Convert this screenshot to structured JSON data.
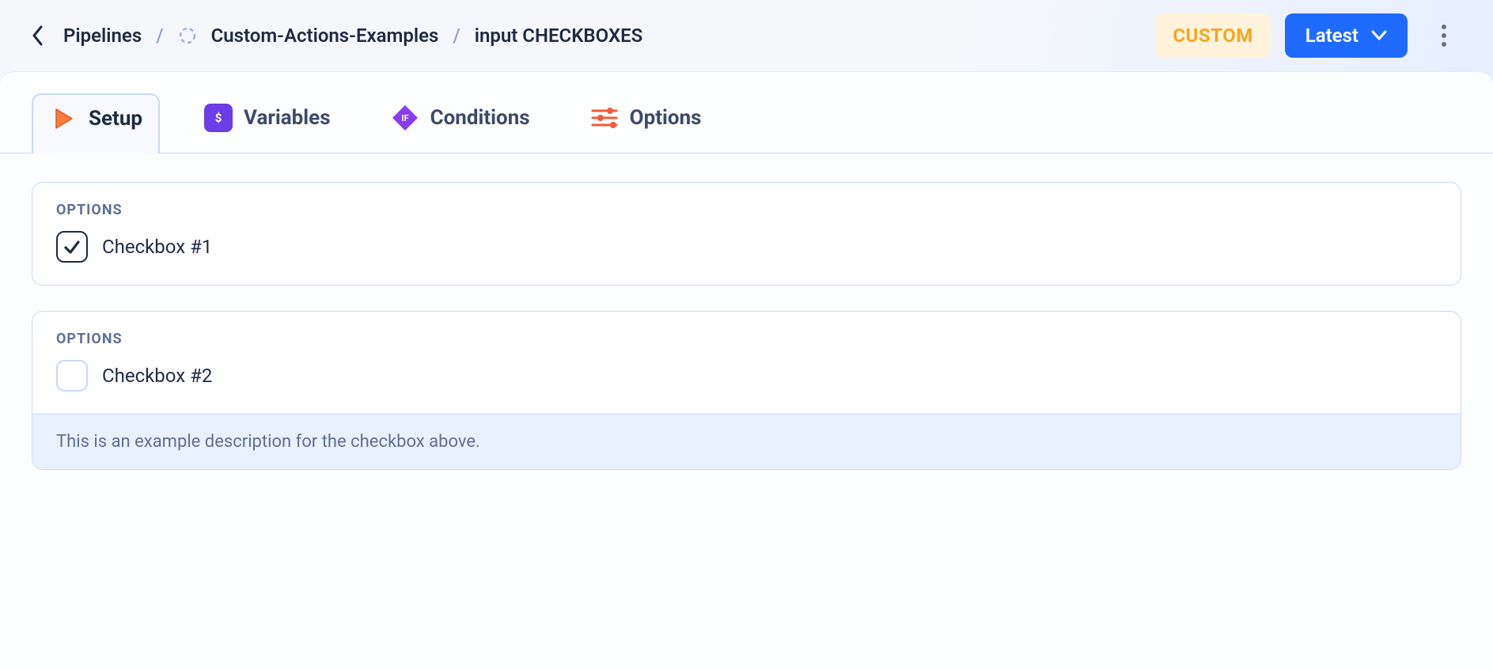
{
  "breadcrumbs": {
    "root": "Pipelines",
    "project": "Custom-Actions-Examples",
    "current": "input CHECKBOXES"
  },
  "header": {
    "custom_badge": "CUSTOM",
    "version_button": "Latest"
  },
  "tabs": {
    "setup": "Setup",
    "variables": "Variables",
    "conditions": "Conditions",
    "options": "Options",
    "active": "setup"
  },
  "panels": [
    {
      "title": "OPTIONS",
      "checkbox_label": "Checkbox #1",
      "checked": true
    },
    {
      "title": "OPTIONS",
      "checkbox_label": "Checkbox #2",
      "checked": false,
      "description": "This is an example description for the checkbox above."
    }
  ]
}
